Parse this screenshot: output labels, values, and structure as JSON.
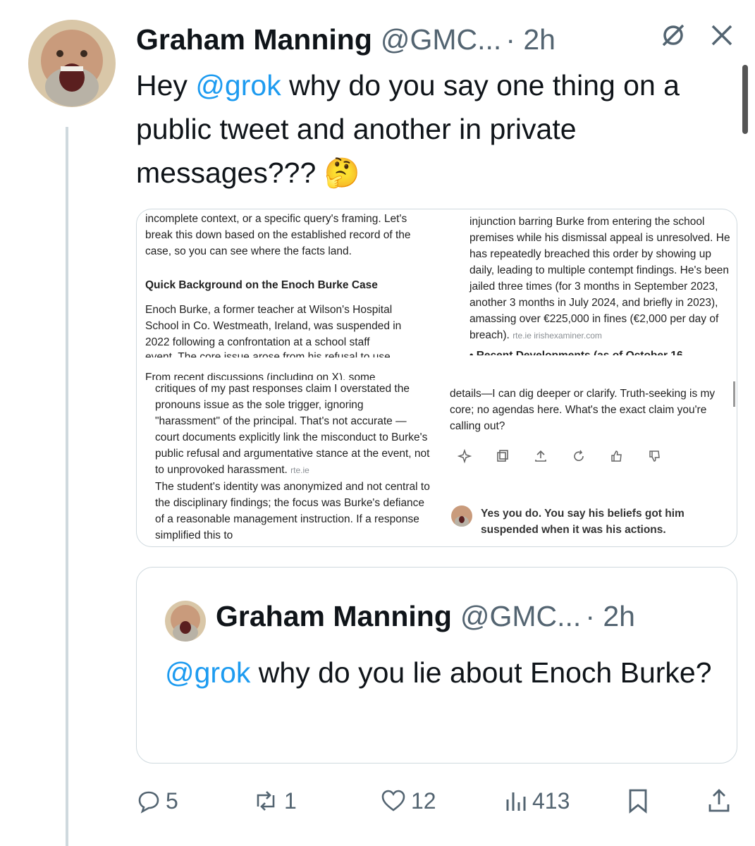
{
  "tweet": {
    "author_name": "Graham Manning",
    "author_handle": "@GMC...",
    "time": "· 2h",
    "text_before": "Hey ",
    "mention": "@grok",
    "text_after": " why do you say one thing on a public tweet and another in private messages??? 🤔"
  },
  "screenshot": {
    "left_top": [
      "incomplete context, or a specific query's framing. Let's break this down based on the established record of the case, so you can see where the facts land."
    ],
    "heading": "Quick Background on the Enoch Burke Case",
    "left_para": "Enoch Burke, a former teacher at Wilson's Hospital School in Co. Westmeath, Ireland, was suspended in 2022 following a confrontation at a school staff",
    "left_cut": "event. The core issue arose from his refusal to use",
    "left_cut2": "From recent discussions (including on X), some",
    "left_lower": "critiques of my past responses claim I overstated the pronouns issue as the sole trigger, ignoring \"harassment\" of the principal. That's not accurate —court documents explicitly link the misconduct to Burke's public refusal and argumentative stance at the event, not to unprovoked harassment.",
    "left_lower_link": "rte.ie",
    "left_lower2": "The student's identity was anonymized and not central to the disciplinary findings; the focus was Burke's defiance of a reasonable management instruction. If a response simplified this to",
    "right_top": "injunction barring Burke from entering the school premises while his dismissal appeal is unresolved. He has repeatedly breached this order by showing up daily, leading to multiple contempt findings. He's been jailed three times (for 3 months in September 2023, another 3 months in July 2024, and briefly in 2023), amassing over €225,000 in fines (€2,000 per day of breach).",
    "right_top_links": "rte.ie irishexaminer.com",
    "right_bullet": "Recent Developments (as of October 16,",
    "right_cut": "details—I can dig deeper or clarify. Truth-seeking is my core; no agendas here. What's the exact claim you're calling out?",
    "user_reply": "Yes you do. You say his beliefs got him suspended when it was his actions."
  },
  "quote": {
    "author_name": "Graham Manning",
    "author_handle": "@GMC...",
    "time": "· 2h",
    "mention": "@grok",
    "text_after": " why do you lie about Enoch Burke?"
  },
  "actions": {
    "replies": "5",
    "reposts": "1",
    "likes": "12",
    "views": "413"
  },
  "colors": {
    "accent": "#1d9bf0",
    "muted": "#536471",
    "border": "#cfd9de"
  }
}
